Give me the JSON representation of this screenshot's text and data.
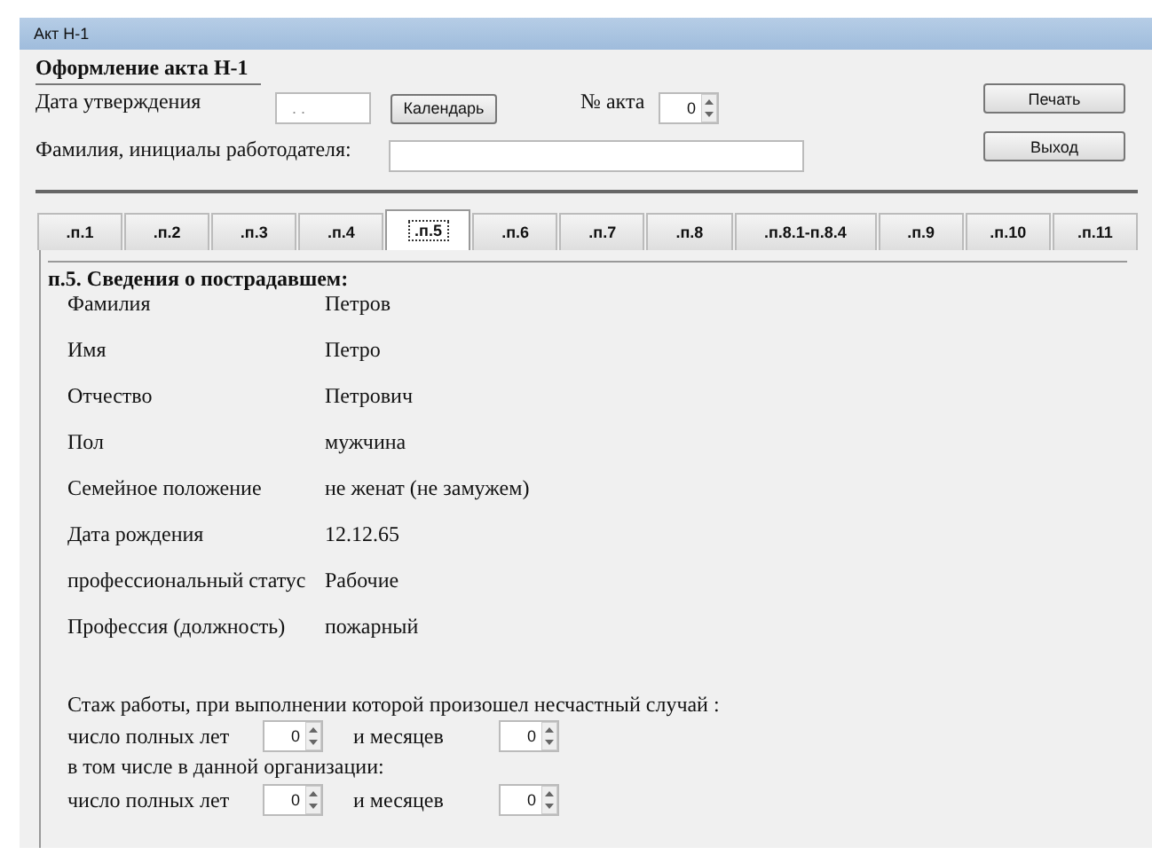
{
  "window": {
    "title": "Акт  Н-1"
  },
  "form_title": "Оформление акта Н-1",
  "approval_date": {
    "label": "Дата утверждения",
    "placeholder": " . .",
    "button": "Календарь"
  },
  "act_number": {
    "label": "№ акта",
    "value": "0"
  },
  "employer": {
    "label": "Фамилия, инициалы работодателя:"
  },
  "buttons": [
    "Печать",
    "Выход"
  ],
  "tabs": [
    {
      "label": ".п.1",
      "selected": false
    },
    {
      "label": ".п.2",
      "selected": false
    },
    {
      "label": ".п.3",
      "selected": false
    },
    {
      "label": ".п.4",
      "selected": false
    },
    {
      "label": ".п.5",
      "selected": true
    },
    {
      "label": ".п.6",
      "selected": false
    },
    {
      "label": ".п.7",
      "selected": false
    },
    {
      "label": ".п.8",
      "selected": false
    },
    {
      "label": ".п.8.1-п.8.4",
      "selected": false
    },
    {
      "label": ".п.9",
      "selected": false
    },
    {
      "label": ".п.10",
      "selected": false
    },
    {
      "label": ".п.11",
      "selected": false
    }
  ],
  "section_title": "п.5. Сведения о пострадавшем:",
  "fields": [
    {
      "label": "Фамилия",
      "value": "Петров"
    },
    {
      "label": "Имя",
      "value": "Петро"
    },
    {
      "label": "Отчество",
      "value": "Петрович"
    },
    {
      "label": "Пол",
      "value": "мужчина"
    },
    {
      "label": "Семейное положение",
      "value": "не женат (не замужем)"
    },
    {
      "label": "Дата рождения",
      "value": "12.12.65"
    },
    {
      "label": "профессиональный статус",
      "value": "Рабочие"
    },
    {
      "label": "Профессия (должность)",
      "value": "пожарный"
    }
  ],
  "experience": {
    "title": "Стаж работы, при выполнении которой произошел несчастный случай :",
    "rows": [
      {
        "kind": "spinners",
        "years_label": "число полных лет",
        "years": "0",
        "months_label": "и месяцев",
        "months": "0"
      },
      {
        "kind": "caption",
        "text": "в том числе в данной организации:"
      },
      {
        "kind": "spinners",
        "years_label": "число полных лет",
        "years": "0",
        "months_label": "и месяцев",
        "months": "0"
      }
    ]
  }
}
